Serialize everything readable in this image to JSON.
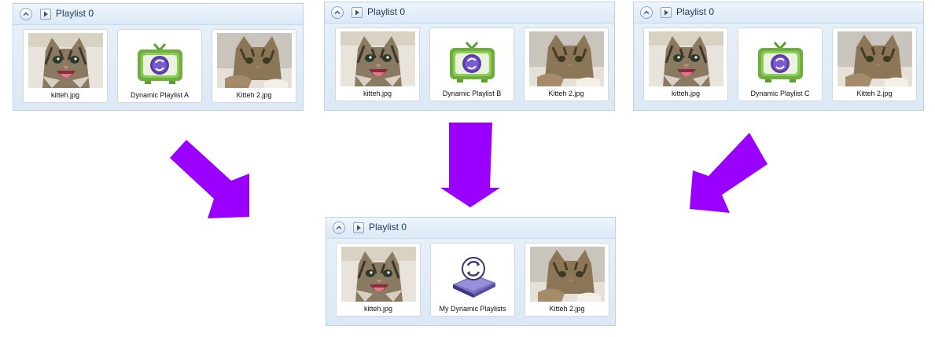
{
  "panels": [
    {
      "id": "panel-a",
      "title": "Playlist 0",
      "items": [
        {
          "label": "kitteh.jpg",
          "icon": "happy-kitten-photo"
        },
        {
          "label": "Dynamic Playlist A",
          "icon": "dynamic-playlist-tv-icon"
        },
        {
          "label": "Kitteh 2.jpg",
          "icon": "tabby-kitten-photo"
        }
      ]
    },
    {
      "id": "panel-b",
      "title": "Playlist 0",
      "items": [
        {
          "label": "kitteh.jpg",
          "icon": "happy-kitten-photo"
        },
        {
          "label": "Dynamic Playlist B",
          "icon": "dynamic-playlist-tv-icon"
        },
        {
          "label": "Kitteh 2.jpg",
          "icon": "tabby-kitten-photo"
        }
      ]
    },
    {
      "id": "panel-c",
      "title": "Playlist 0",
      "items": [
        {
          "label": "kitteh.jpg",
          "icon": "happy-kitten-photo"
        },
        {
          "label": "Dynamic Playlist C",
          "icon": "dynamic-playlist-tv-icon"
        },
        {
          "label": "Kitteh 2.jpg",
          "icon": "tabby-kitten-photo"
        }
      ]
    },
    {
      "id": "panel-result",
      "title": "Playlist 0",
      "items": [
        {
          "label": "kitteh.jpg",
          "icon": "happy-kitten-photo"
        },
        {
          "label": "My Dynamic Playlists",
          "icon": "dynamic-playlists-folder-icon"
        },
        {
          "label": "Kitteh 2.jpg",
          "icon": "tabby-kitten-photo"
        }
      ]
    }
  ],
  "colors": {
    "arrow": "#9900ff",
    "panel_border": "#bcd0e6",
    "title_text": "#1e3a5c",
    "tv_green": "#7ab648",
    "disc_purple": "#5b3aa8",
    "folder_purple": "#5a50a8"
  }
}
